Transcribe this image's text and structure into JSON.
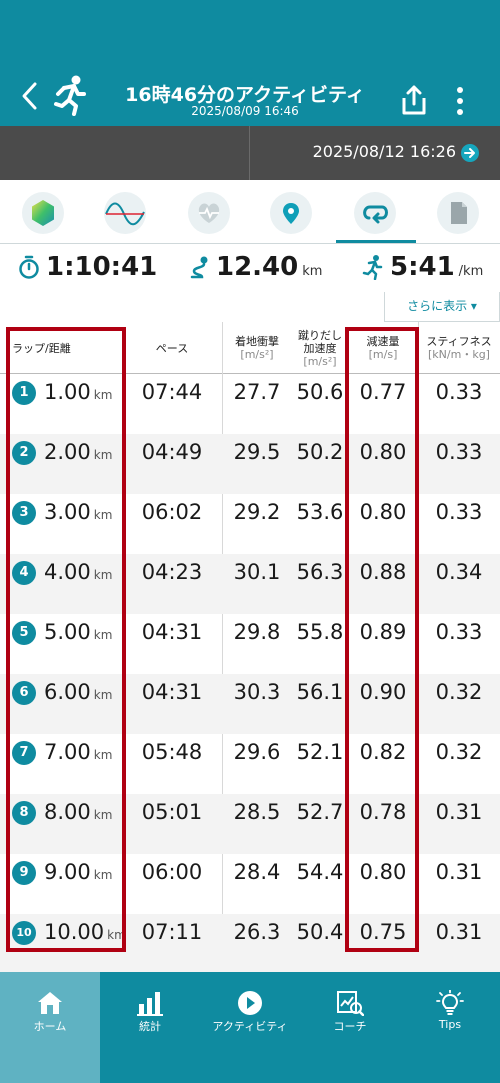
{
  "header": {
    "title": "16時46分のアクティビティ",
    "subtitle": "2025/08/09 16:46"
  },
  "date_bar": {
    "date": "2025/08/12 16:26"
  },
  "icon_tabs": [
    {
      "icon": "hexagon-icon",
      "active": false
    },
    {
      "icon": "wave-chart-icon",
      "active": false
    },
    {
      "icon": "heart-rate-icon",
      "active": false
    },
    {
      "icon": "map-pin-icon",
      "active": false
    },
    {
      "icon": "lap-loop-icon",
      "active": true
    },
    {
      "icon": "document-icon",
      "active": false
    }
  ],
  "summary": {
    "time": "1:10:41",
    "distance": "12.40",
    "distance_unit": "km",
    "pace": "5:41",
    "pace_unit": "/km"
  },
  "more_button": "さらに表示 ▾",
  "table": {
    "headers": {
      "lap": "ラップ/距離",
      "pace": "ペース",
      "impact": "着地衝撃",
      "impact_unit": "[m/s²]",
      "push_line1": "蹴りだし",
      "push_line2": "加速度",
      "push_unit": "[m/s²]",
      "brake": "減速量",
      "brake_unit": "[m/s]",
      "stiff": "スティフネス",
      "stiff_unit": "[kN/m・kg]"
    },
    "rows": [
      {
        "lap": "1",
        "dist": "1.00",
        "unit": "km",
        "pace": "07:44",
        "impact": "27.7",
        "push": "50.6",
        "brake": "0.77",
        "stiff": "0.33"
      },
      {
        "lap": "2",
        "dist": "2.00",
        "unit": "km",
        "pace": "04:49",
        "impact": "29.5",
        "push": "50.2",
        "brake": "0.80",
        "stiff": "0.33"
      },
      {
        "lap": "3",
        "dist": "3.00",
        "unit": "km",
        "pace": "06:02",
        "impact": "29.2",
        "push": "53.6",
        "brake": "0.80",
        "stiff": "0.33"
      },
      {
        "lap": "4",
        "dist": "4.00",
        "unit": "km",
        "pace": "04:23",
        "impact": "30.1",
        "push": "56.3",
        "brake": "0.88",
        "stiff": "0.34"
      },
      {
        "lap": "5",
        "dist": "5.00",
        "unit": "km",
        "pace": "04:31",
        "impact": "29.8",
        "push": "55.8",
        "brake": "0.89",
        "stiff": "0.33"
      },
      {
        "lap": "6",
        "dist": "6.00",
        "unit": "km",
        "pace": "04:31",
        "impact": "30.3",
        "push": "56.1",
        "brake": "0.90",
        "stiff": "0.32"
      },
      {
        "lap": "7",
        "dist": "7.00",
        "unit": "km",
        "pace": "05:48",
        "impact": "29.6",
        "push": "52.1",
        "brake": "0.82",
        "stiff": "0.32"
      },
      {
        "lap": "8",
        "dist": "8.00",
        "unit": "km",
        "pace": "05:01",
        "impact": "28.5",
        "push": "52.7",
        "brake": "0.78",
        "stiff": "0.31"
      },
      {
        "lap": "9",
        "dist": "9.00",
        "unit": "km",
        "pace": "06:00",
        "impact": "28.4",
        "push": "54.4",
        "brake": "0.80",
        "stiff": "0.31"
      },
      {
        "lap": "10",
        "dist": "10.00",
        "unit": "km",
        "pace": "07:11",
        "impact": "26.3",
        "push": "50.4",
        "brake": "0.75",
        "stiff": "0.31"
      }
    ]
  },
  "bottom_nav": [
    {
      "label": "ホーム",
      "icon": "home-icon",
      "active": true
    },
    {
      "label": "統計",
      "icon": "bar-chart-icon",
      "active": false
    },
    {
      "label": "アクティビティ",
      "icon": "play-circle-icon",
      "active": false
    },
    {
      "label": "コーチ",
      "icon": "coach-chart-icon",
      "active": false
    },
    {
      "label": "Tips",
      "icon": "lightbulb-icon",
      "active": false
    }
  ],
  "colors": {
    "brand": "#0f8ba0",
    "highlight": "#b00012",
    "dark_bar": "#4b4b4b"
  }
}
